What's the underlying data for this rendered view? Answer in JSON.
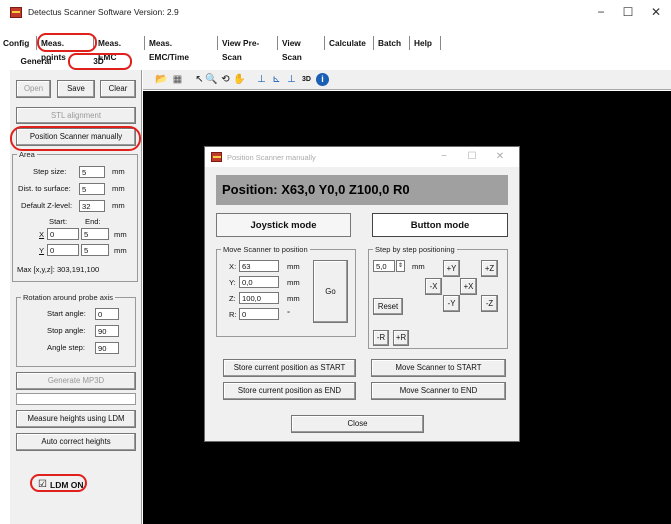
{
  "window": {
    "title": "Detectus Scanner Software Version: 2.9",
    "minimize": "−",
    "maximize": "☐",
    "close": "✕"
  },
  "menu": [
    "Config",
    "Meas. points",
    "Meas. EMC",
    "Meas. EMC/Time",
    "View Pre-Scan",
    "View Scan",
    "Calculate",
    "Batch",
    "Help"
  ],
  "subtabs": [
    "General",
    "3D"
  ],
  "left": {
    "open": "Open",
    "save": "Save",
    "clear": "Clear",
    "stl_alignment": "STL alignment",
    "position_manually": "Position Scanner manually",
    "area_title": "Area",
    "step_size_label": "Step size:",
    "step_size": "5",
    "dist_label": "Dist. to surface:",
    "dist": "5",
    "default_z_label": "Default Z-level:",
    "default_z": "32",
    "unit_mm": "mm",
    "start_label": "Start:",
    "end_label": "End:",
    "x_label": "X",
    "x_start": "0",
    "x_end": "5",
    "y_label": "Y",
    "y_start": "0",
    "y_end": "5",
    "max_xyz": "Max [x,y,z]: 303,191,100",
    "rotation_title": "Rotation around probe axis",
    "start_angle_label": "Start angle:",
    "start_angle": "0",
    "stop_angle_label": "Stop angle:",
    "stop_angle": "90",
    "angle_step_label": "Angle step:",
    "angle_step": "90",
    "generate_mp3d": "Generate MP3D",
    "measure_ldm": "Measure heights using LDM",
    "auto_correct": "Auto correct heights",
    "ldm_on": "LDM ON",
    "ldm_checkmark": "☑"
  },
  "toolbar": {
    "icons": [
      "📂",
      "▦",
      "↖",
      "🔍",
      "⟲",
      "✋",
      "⊥",
      "⊾",
      "⊥",
      "3D",
      "i"
    ]
  },
  "dialog": {
    "title": "Position Scanner manually",
    "minimize": "−",
    "maximize": "☐",
    "close": "✕",
    "position": "Position: X63,0 Y0,0 Z100,0 R0",
    "joystick_mode": "Joystick mode",
    "button_mode": "Button mode",
    "move_group": "Move Scanner to position",
    "x_label": "X:",
    "x_val": "63",
    "y_label": "Y:",
    "y_val": "0,0",
    "z_label": "Z:",
    "z_val": "100,0",
    "r_label": "R:",
    "r_val": "0",
    "unit_mm": "mm",
    "unit_deg": "°",
    "go": "Go",
    "step_group": "Step by step positioning",
    "step_val": "5,0",
    "step_unit": "mm",
    "plus_y": "+Y",
    "plus_z": "+Z",
    "minus_x": "-X",
    "plus_x": "+X",
    "minus_y": "-Y",
    "minus_z": "-Z",
    "reset": "Reset",
    "minus_r": "-R",
    "plus_r": "+R",
    "store_start": "Store current position as START",
    "move_start": "Move Scanner to START",
    "store_end": "Store current position as END",
    "move_end": "Move Scanner to END",
    "close_btn": "Close"
  },
  "colors": {
    "annotation_red": "#e0201b",
    "canvas": "#000000",
    "position_bar": "#a0a0a0"
  }
}
